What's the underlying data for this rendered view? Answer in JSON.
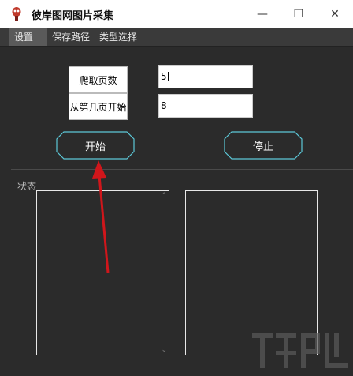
{
  "window": {
    "title": "彼岸图网图片采集",
    "minimize_glyph": "—",
    "restore_glyph": "❐",
    "close_glyph": "✕"
  },
  "menu": {
    "items": [
      {
        "label": "设置",
        "active": true
      },
      {
        "label": "保存路径",
        "active": false
      },
      {
        "label": "类型选择",
        "active": false
      }
    ]
  },
  "form": {
    "pages_label": "爬取页数",
    "pages_value": "5",
    "start_page_label": "从第几页开始",
    "start_page_value": "8"
  },
  "buttons": {
    "start_label": "开始",
    "stop_label": "停止"
  },
  "status": {
    "label": "状态"
  },
  "colors": {
    "accent_border": "#5cc8d8",
    "arrow": "#d0161b",
    "background": "#2b2b2b"
  },
  "icons": [
    "app-icon",
    "minimize-icon",
    "restore-icon",
    "close-icon",
    "arrow-annotation"
  ]
}
